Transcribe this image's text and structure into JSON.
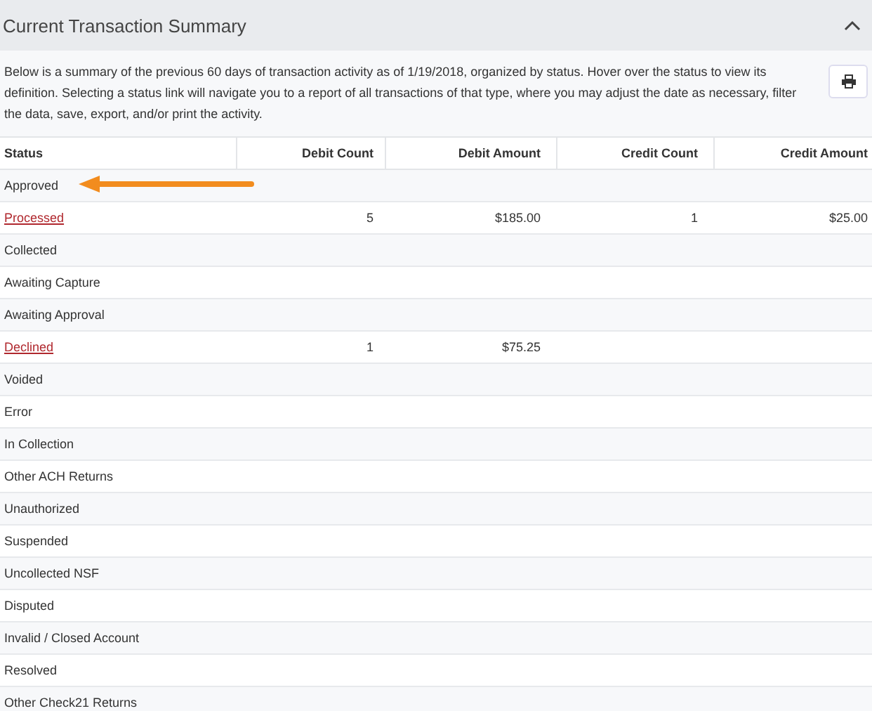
{
  "panel": {
    "title": "Current Transaction Summary",
    "expanded": true
  },
  "description": "Below is a summary of the previous 60 days of transaction activity as of 1/19/2018, organized by status. Hover over the status to view its definition. Selecting a status link will navigate you to a report of all transactions of that type, where you may adjust the date as necessary, filter the data, save, export, and/or print the activity.",
  "table": {
    "columns": [
      "Status",
      "Debit Count",
      "Debit Amount",
      "Credit Count",
      "Credit Amount"
    ],
    "rows": [
      {
        "link": false,
        "cells": [
          "Approved",
          "",
          "",
          "",
          ""
        ]
      },
      {
        "link": true,
        "cells": [
          "Processed",
          "5",
          "$185.00",
          "1",
          "$25.00"
        ]
      },
      {
        "link": false,
        "cells": [
          "Collected",
          "",
          "",
          "",
          ""
        ]
      },
      {
        "link": false,
        "cells": [
          "Awaiting Capture",
          "",
          "",
          "",
          ""
        ]
      },
      {
        "link": false,
        "cells": [
          "Awaiting Approval",
          "",
          "",
          "",
          ""
        ]
      },
      {
        "link": true,
        "cells": [
          "Declined",
          "1",
          "$75.25",
          "",
          ""
        ]
      },
      {
        "link": false,
        "cells": [
          "Voided",
          "",
          "",
          "",
          ""
        ]
      },
      {
        "link": false,
        "cells": [
          "Error",
          "",
          "",
          "",
          ""
        ]
      },
      {
        "link": false,
        "cells": [
          "In Collection",
          "",
          "",
          "",
          ""
        ]
      },
      {
        "link": false,
        "cells": [
          "Other ACH Returns",
          "",
          "",
          "",
          ""
        ]
      },
      {
        "link": false,
        "cells": [
          "Unauthorized",
          "",
          "",
          "",
          ""
        ]
      },
      {
        "link": false,
        "cells": [
          "Suspended",
          "",
          "",
          "",
          ""
        ]
      },
      {
        "link": false,
        "cells": [
          "Uncollected NSF",
          "",
          "",
          "",
          ""
        ]
      },
      {
        "link": false,
        "cells": [
          "Disputed",
          "",
          "",
          "",
          ""
        ]
      },
      {
        "link": false,
        "cells": [
          "Invalid / Closed Account",
          "",
          "",
          "",
          ""
        ]
      },
      {
        "link": false,
        "cells": [
          "Resolved",
          "",
          "",
          "",
          ""
        ]
      },
      {
        "link": false,
        "cells": [
          "Other Check21 Returns",
          "",
          "",
          "",
          ""
        ]
      }
    ]
  },
  "annotation": {
    "kind": "arrow"
  }
}
